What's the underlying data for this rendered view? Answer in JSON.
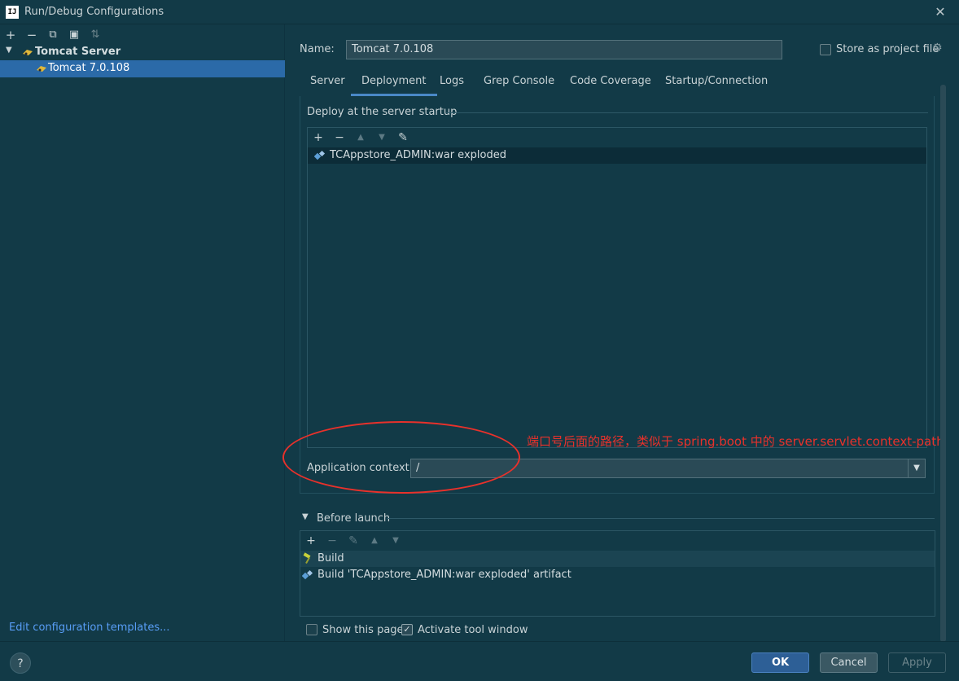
{
  "window": {
    "app_icon": "IJ",
    "title": "Run/Debug Configurations",
    "close_symbol": "✕"
  },
  "left_toolbar": {
    "add": "+",
    "remove": "−",
    "copy": "⧉",
    "folder": "▣",
    "sort": "⇅"
  },
  "tree": {
    "root_label": "Tomcat Server",
    "child_label": "Tomcat 7.0.108"
  },
  "edit_templates_link": "Edit configuration templates...",
  "help": "?",
  "name_field": {
    "label": "Name:",
    "value": "Tomcat 7.0.108"
  },
  "store_as_project_file": {
    "label": "Store as project file",
    "checked": false
  },
  "tabs": [
    {
      "label": "Server"
    },
    {
      "label": "Deployment",
      "active": true
    },
    {
      "label": "Logs"
    },
    {
      "label": "Grep Console"
    },
    {
      "label": "Code Coverage"
    },
    {
      "label": "Startup/Connection"
    }
  ],
  "deploy": {
    "section_title": "Deploy at the server startup",
    "toolbar": {
      "add": "+",
      "remove": "−",
      "up": "▲",
      "down": "▼",
      "edit": "✎"
    },
    "items": [
      "TCAppstore_ADMIN:war exploded"
    ]
  },
  "application_context": {
    "label": "Application context:",
    "value": "/",
    "dropdown_symbol": "▼"
  },
  "annotation": {
    "text": "端口号后面的路径，类似于 spring.boot 中的 server.servlet.context-path",
    "color": "#e8312b"
  },
  "before_launch": {
    "toggle_symbol": "▼",
    "title": "Before launch",
    "toolbar": {
      "add": "+",
      "remove": "−",
      "edit": "✎",
      "up": "▲",
      "down": "▼"
    },
    "items": [
      {
        "label": "Build"
      },
      {
        "label": "Build 'TCAppstore_ADMIN:war exploded' artifact"
      }
    ]
  },
  "options": {
    "show_this_page": {
      "label": "Show this page",
      "checked": false
    },
    "activate_tool_window": {
      "label": "Activate tool window",
      "checked": true,
      "check_symbol": "✓"
    }
  },
  "buttons": {
    "ok": "OK",
    "cancel": "Cancel",
    "apply": "Apply"
  },
  "colors": {
    "background": "#123a47",
    "selection": "#2b6aa8",
    "accent": "#4a88c7",
    "link": "#589df6"
  }
}
